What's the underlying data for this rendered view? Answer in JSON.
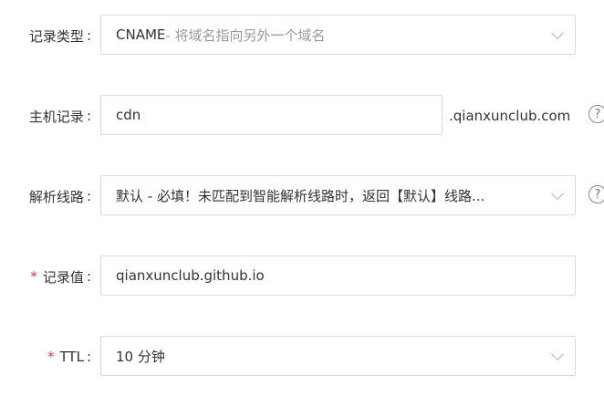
{
  "record_type": {
    "label": "记录类型",
    "colon": ":",
    "value": "CNAME",
    "hint": "- 将域名指向另外一个域名"
  },
  "host_record": {
    "label": "主机记录",
    "colon": ":",
    "value": "cdn",
    "suffix": ".qianxunclub.com",
    "help_icon": "?"
  },
  "resolve_line": {
    "label": "解析线路",
    "colon": ":",
    "value": "默认 - 必填！未匹配到智能解析线路时，返回【默认】线路...",
    "help_icon": "?"
  },
  "record_value": {
    "required_mark": "*",
    "label": "记录值",
    "colon": ":",
    "value": "qianxunclub.github.io"
  },
  "ttl": {
    "required_mark": "*",
    "label": "TTL",
    "colon": ":",
    "value": "10 分钟"
  },
  "colors": {
    "required": "#e4393c",
    "border": "#d9d9d9",
    "muted_text": "#999999"
  }
}
